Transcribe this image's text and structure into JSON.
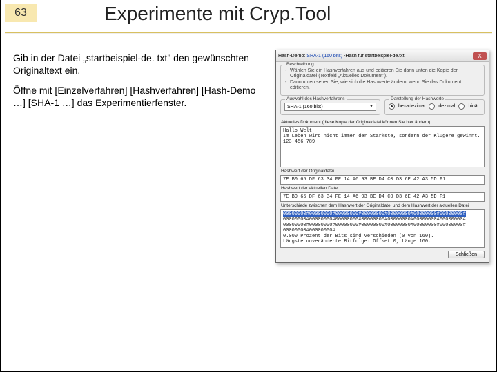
{
  "slide": {
    "page_number": "63",
    "title": "Experimente mit Cryp.Tool"
  },
  "body": {
    "p1": "Gib in der Datei „startbeispiel-de. txt\" den gewünschten Originaltext ein.",
    "p2": "Öffne mit [Einzelverfahren] [Hashverfahren] [Hash-Demo …] [SHA-1 …] das Experimentierfenster."
  },
  "dialog": {
    "title_prefix": "Hash-Demo:",
    "title_alg": "SHA-1 (160 bits)",
    "title_suffix": "-Hash für startbeispiel-de.txt",
    "close_x": "X",
    "desc_group": "Beschreibung",
    "desc_lines": [
      "Wählen Sie ein Hashverfahren aus und editieren Sie dann unten die Kopie der Originaldatei (Textfeld „Aktuelles Dokument\").",
      "Dann unten sehen Sie, wie sich die Hashwerte ändern, wenn Sie das Dokument editieren."
    ],
    "hash_select_group": "Auswahl des Hashverfahrens",
    "hash_select_value": "SHA-1 (160 bits)",
    "format_group": "Darstellung der Hashwerte",
    "format_options": [
      "hexadezimal",
      "dezimal",
      "binär"
    ],
    "format_selected_index": 0,
    "editor_label": "Aktuelles Dokument (diese Kopie der Originaldatei können Sie hier ändern)",
    "editor_text": "Hallo Welt\nIm Leben wird nicht immer der Stärkste, sondern der Klügere gewinnt.\n123 456 789",
    "hash_orig_label": "Hashwert der Originaldatei",
    "hash_orig_value": "7E B0 65 DF 63 34 FE 14 A6 93 BE D4 C0 D3 6E 42 A3 5D F1",
    "hash_curr_label": "Hashwert der aktuellen Datei",
    "hash_curr_value": "7E B0 65 DF 63 34 FE 14 A6 93 BE D4 C0 D3 6E 42 A3 5D F1",
    "diff_label": "Unterschiede zwischen dem Hashwert der Originaldatei und dem Hashwert der aktuellen Datei",
    "diff_row_highlight": "00000000#00000000#00000000#00000000#00000000#00000000#00000000#",
    "diff_rows": [
      "00000000#00000000#00000000#00000000#00000000#00000000#00000000#",
      "00000000#00000000#00000000#00000000#00000000#00000000#00000000#",
      "00000000#00000000#",
      "0.000 Prozent der Bits sind verschieden (0 von 160).",
      "Längste unveränderte Bitfolge: Offset 0, Länge 160."
    ],
    "close_button": "Schließen"
  }
}
